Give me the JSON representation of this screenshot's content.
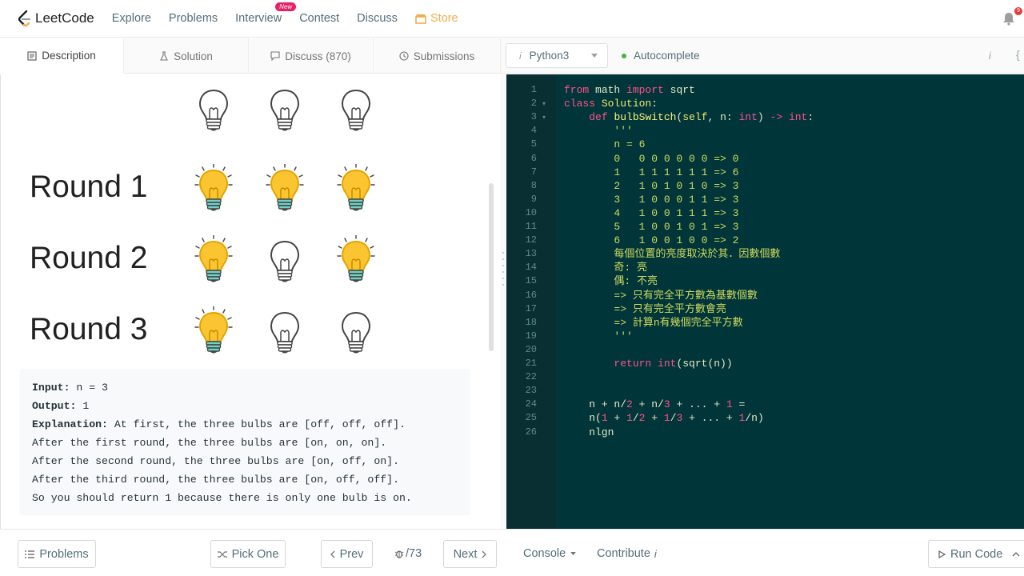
{
  "nav": {
    "logo_text": "LeetCode",
    "items": [
      "Explore",
      "Problems",
      "Interview",
      "Contest",
      "Discuss"
    ],
    "new_badge": "New",
    "store": "Store",
    "notification_count": "9"
  },
  "left_tabs": {
    "description": "Description",
    "solution": "Solution",
    "discuss": "Discuss (870)",
    "submissions": "Submissions"
  },
  "illustration": {
    "rounds": [
      "Round 1",
      "Round 2",
      "Round 3"
    ],
    "initial_state": [
      "off",
      "off",
      "off"
    ],
    "round_states": [
      [
        "on",
        "on",
        "on"
      ],
      [
        "on",
        "off",
        "on"
      ],
      [
        "on",
        "off",
        "off"
      ]
    ]
  },
  "example": {
    "input_label": "Input:",
    "input_value": "n = 3",
    "output_label": "Output:",
    "output_value": "1",
    "explanation_label": "Explanation:",
    "explanation_first": "At first, the three bulbs are [off, off, off].",
    "lines": [
      "After the first round, the three bulbs are [on, on, on].",
      "After the second round, the three bulbs are [on, off, on].",
      "After the third round, the three bulbs are [on, off, off].",
      "So you should return 1 because there is only one bulb is on."
    ]
  },
  "editor_toolbar": {
    "info_glyph": "i",
    "language": "Python3",
    "autocomplete": "Autocomplete"
  },
  "code": {
    "line_numbers": [
      "1",
      "2",
      "3",
      "4",
      "5",
      "6",
      "7",
      "8",
      "9",
      "10",
      "11",
      "12",
      "13",
      "14",
      "15",
      "16",
      "17",
      "18",
      "19",
      "20",
      "21",
      "22",
      "23",
      "24",
      "25",
      "26"
    ],
    "lines": [
      [
        [
          "kw",
          "from"
        ],
        [
          "plain",
          " math "
        ],
        [
          "kw",
          "import"
        ],
        [
          "plain",
          " sqrt"
        ]
      ],
      [
        [
          "kw",
          "class"
        ],
        [
          "plain",
          " "
        ],
        [
          "cls",
          "Solution"
        ],
        [
          "plain",
          ":"
        ]
      ],
      [
        [
          "plain",
          "    "
        ],
        [
          "kw",
          "def"
        ],
        [
          "plain",
          " "
        ],
        [
          "fn",
          "bulbSwitch"
        ],
        [
          "plain",
          "("
        ],
        [
          "cls",
          "self"
        ],
        [
          "plain",
          ", n: "
        ],
        [
          "kw",
          "int"
        ],
        [
          "plain",
          ") "
        ],
        [
          "kw",
          "->"
        ],
        [
          "plain",
          " "
        ],
        [
          "kw",
          "int"
        ],
        [
          "plain",
          ":"
        ]
      ],
      [
        [
          "str",
          "        '''"
        ]
      ],
      [
        [
          "str",
          "        n = 6"
        ]
      ],
      [
        [
          "str",
          "        0   0 0 0 0 0 0 => 0"
        ]
      ],
      [
        [
          "str",
          "        1   1 1 1 1 1 1 => 6"
        ]
      ],
      [
        [
          "str",
          "        2   1 0 1 0 1 0 => 3"
        ]
      ],
      [
        [
          "str",
          "        3   1 0 0 0 1 1 => 3"
        ]
      ],
      [
        [
          "str",
          "        4   1 0 0 1 1 1 => 3"
        ]
      ],
      [
        [
          "str",
          "        5   1 0 0 1 0 1 => 3"
        ]
      ],
      [
        [
          "str",
          "        6   1 0 0 1 0 0 => 2"
        ]
      ],
      [
        [
          "str",
          "        每個位置的亮度取決於其．因數個數"
        ]
      ],
      [
        [
          "str",
          "        奇: 亮"
        ]
      ],
      [
        [
          "str",
          "        偶: 不亮"
        ]
      ],
      [
        [
          "str",
          "        => 只有完全平方數為基數個數"
        ]
      ],
      [
        [
          "str",
          "        => 只有完全平方數會亮"
        ]
      ],
      [
        [
          "str",
          "        => 計算n有幾個完全平方數"
        ]
      ],
      [
        [
          "str",
          "        '''"
        ]
      ],
      [
        [
          "plain",
          ""
        ]
      ],
      [
        [
          "plain",
          "        "
        ],
        [
          "kw",
          "return"
        ],
        [
          "plain",
          " "
        ],
        [
          "kw",
          "int"
        ],
        [
          "plain",
          "(sqrt(n))"
        ]
      ],
      [
        [
          "plain",
          ""
        ]
      ],
      [
        [
          "plain",
          ""
        ]
      ],
      [
        [
          "plain",
          "    n + n/"
        ],
        [
          "num",
          "2"
        ],
        [
          "plain",
          " + n/"
        ],
        [
          "num",
          "3"
        ],
        [
          "plain",
          " + ... + "
        ],
        [
          "num",
          "1"
        ],
        [
          "plain",
          " ="
        ]
      ],
      [
        [
          "plain",
          "    n("
        ],
        [
          "num",
          "1"
        ],
        [
          "plain",
          " + "
        ],
        [
          "num",
          "1"
        ],
        [
          "plain",
          "/"
        ],
        [
          "num",
          "2"
        ],
        [
          "plain",
          " + "
        ],
        [
          "num",
          "1"
        ],
        [
          "plain",
          "/"
        ],
        [
          "num",
          "3"
        ],
        [
          "plain",
          " + ... + "
        ],
        [
          "num",
          "1"
        ],
        [
          "plain",
          "/n)"
        ]
      ],
      [
        [
          "plain",
          "    nlgn"
        ]
      ]
    ]
  },
  "bottom": {
    "problems": "Problems",
    "pick_one": "Pick One",
    "prev": "Prev",
    "page": "/73",
    "next": "Next",
    "console": "Console",
    "contribute": "Contribute",
    "contribute_info": "i",
    "run_code": "Run Code"
  },
  "colors": {
    "editor_bg": "#00363a",
    "keyword": "#ff4f8b",
    "string": "#cfd95d",
    "store": "#f0ad4e",
    "new_badge": "#e91e63",
    "autocomplete_dot": "#4caf50"
  }
}
